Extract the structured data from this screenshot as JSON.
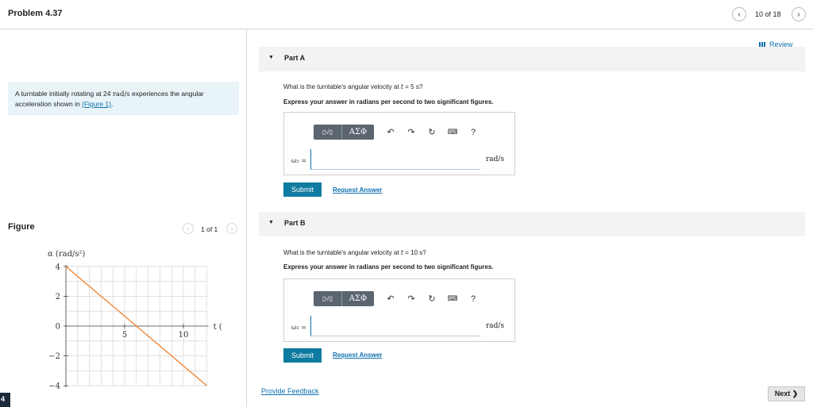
{
  "header": {
    "problem_title": "Problem 4.37",
    "page_count": "10 of 18",
    "prev_icon": "chevron-left-icon",
    "next_icon": "chevron-right-icon"
  },
  "intro": {
    "text_before": "A turntable initially rotating at 24 ",
    "unit": "rad/s",
    "text_after": " experiences the angular acceleration shown in ",
    "figure_link": "(Figure 1)",
    "end": "."
  },
  "figure": {
    "label": "Figure",
    "count": "1 of 1"
  },
  "chart_data": {
    "type": "line",
    "ylabel": "α (rad/s²)",
    "xlabel": "t (s)",
    "x_ticks": [
      "5",
      "10"
    ],
    "y_ticks": [
      "4",
      "2",
      "0",
      "−2",
      "−4"
    ],
    "xlim": [
      0,
      12
    ],
    "ylim": [
      -4,
      4
    ],
    "grid": true,
    "line_color": "#f08a3c",
    "series": [
      {
        "x": [
          0,
          12
        ],
        "y": [
          4,
          -4
        ]
      }
    ]
  },
  "review": "Review",
  "parts": [
    {
      "title": "Part A",
      "question_before": "What is the turntable's angular velocity at ",
      "question_var": "t",
      "question_after": " = 5 s?",
      "instruction": "Express your answer in radians per second to two significant figures.",
      "var_label": "ω₁ =",
      "input_value": "",
      "unit": "rad/s",
      "submit": "Submit",
      "request": "Request Answer"
    },
    {
      "title": "Part B",
      "question_before": "What is the turntable's angular velocity at ",
      "question_var": "t",
      "question_after": " = 10 s?",
      "instruction": "Express your answer in radians per second to two significant figures.",
      "var_label": "ω₂ =",
      "input_value": "",
      "unit": "rad/s",
      "submit": "Submit",
      "request": "Request Answer"
    }
  ],
  "toolbar": {
    "templates": "▯√▯",
    "symbols": "ΑΣΦ",
    "undo": "↶",
    "redo": "↷",
    "reset": "↻",
    "keyboard": "⌨",
    "help": "?"
  },
  "footer": {
    "feedback": "Provide Feedback",
    "next": "Next ❯",
    "badge": "4"
  }
}
